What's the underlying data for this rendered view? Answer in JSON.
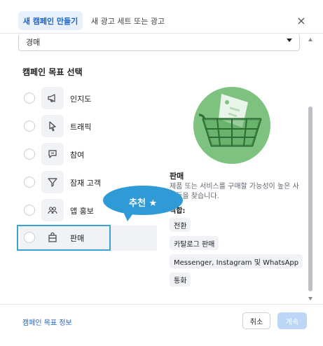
{
  "header": {
    "tab_active": "새 캠페인 만들기",
    "tab_other": "새 광고 세트 또는 광고",
    "close_symbol": "×"
  },
  "dropdown": {
    "value": "경매"
  },
  "section_title": "캠페인 목표 선택",
  "objectives": [
    {
      "label": "인지도",
      "icon": "megaphone-icon"
    },
    {
      "label": "트래픽",
      "icon": "cursor-icon"
    },
    {
      "label": "참여",
      "icon": "chat-bubble-icon"
    },
    {
      "label": "잠재 고객",
      "icon": "funnel-icon"
    },
    {
      "label": "앱 홍보",
      "icon": "people-icon"
    },
    {
      "label": "판매",
      "icon": "shopping-bag-icon"
    }
  ],
  "selected_objective": "판매",
  "detail": {
    "title": "판매",
    "description": "제품 또는 서비스를 구매할 가능성이 높은 사람들을 찾습니다.",
    "subtitle": "적합:",
    "chips": [
      "전환",
      "카탈로그 판매",
      "Messenger, Instagram 및 WhatsApp",
      "통화"
    ]
  },
  "tooltip": {
    "text": "추천 ★",
    "color": "#2f9bd6"
  },
  "footer": {
    "link": "캠페인 목표 정보",
    "cancel": "취소",
    "continue": "계속"
  },
  "colors": {
    "accent": "#1d64c8",
    "highlight_border": "#3aa3d6",
    "illustration": "#7dc37f"
  }
}
